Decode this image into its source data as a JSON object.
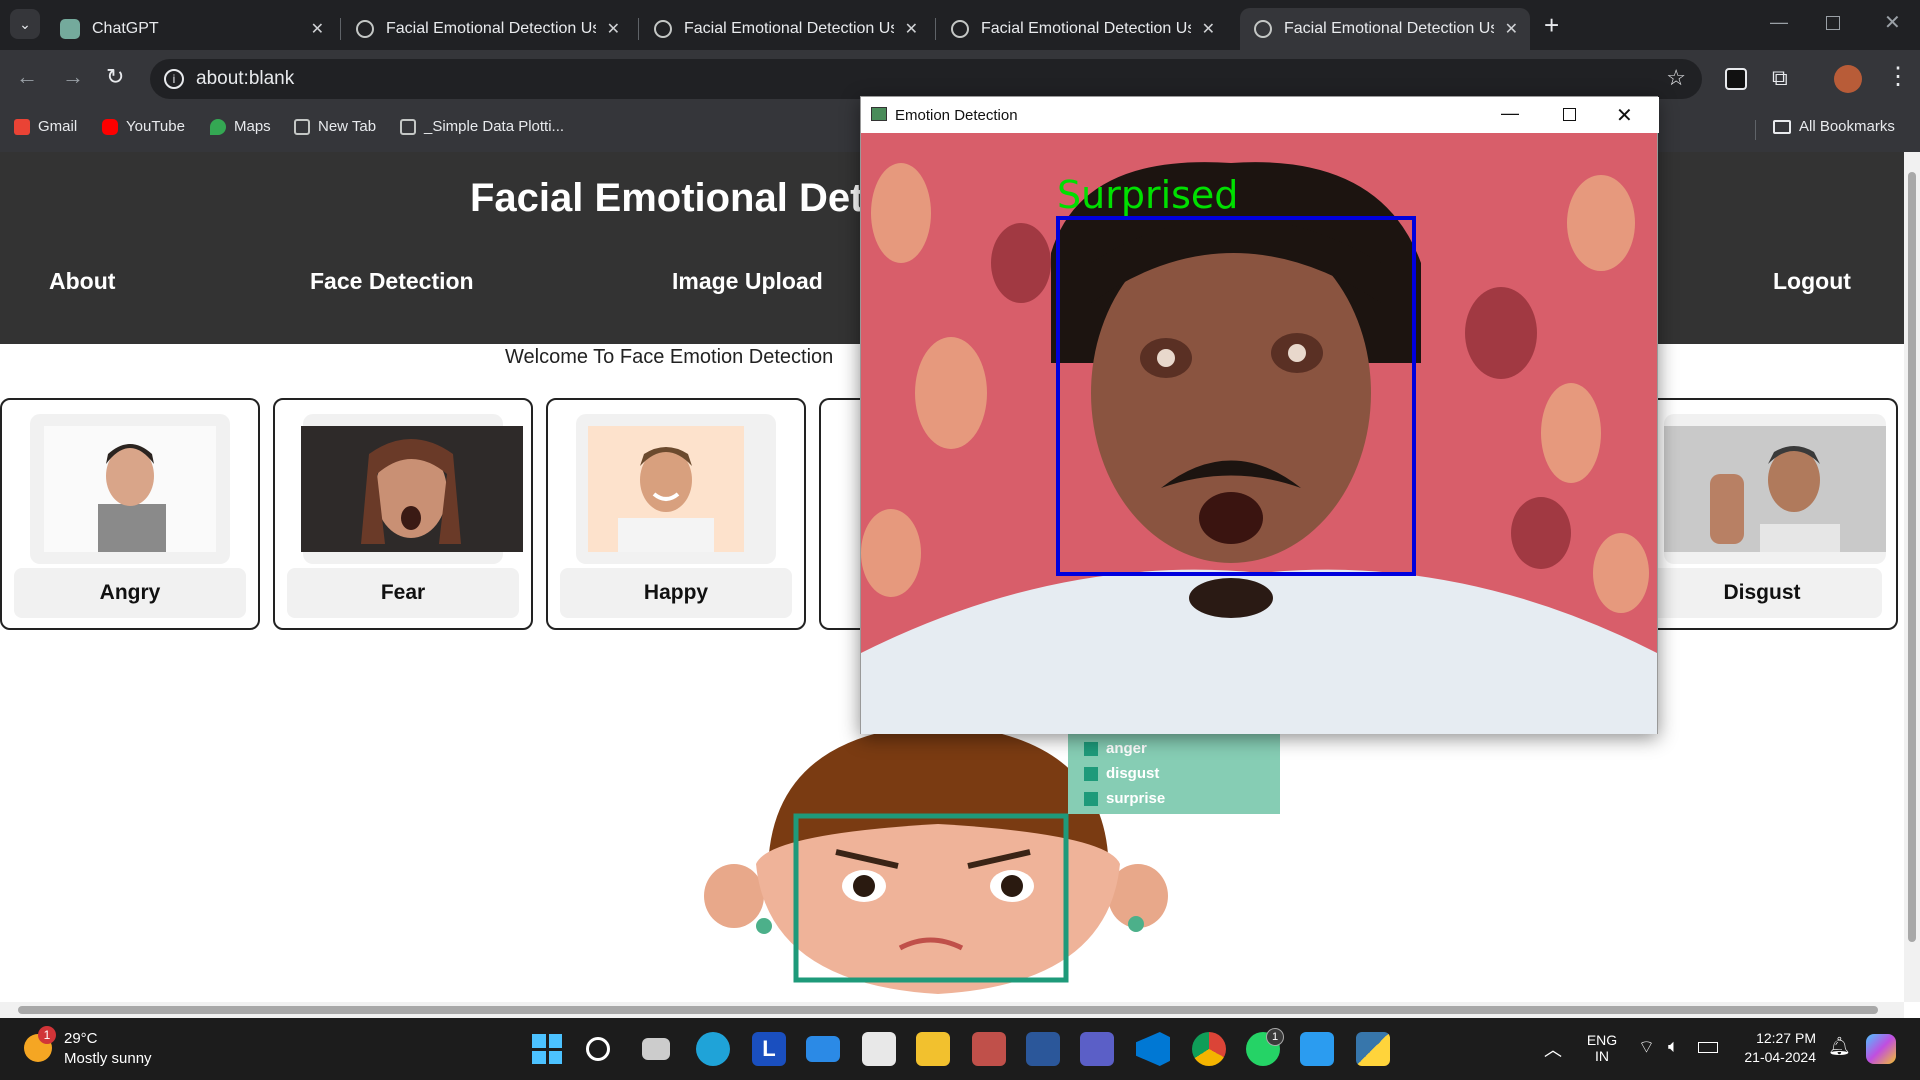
{
  "browser": {
    "tabs": [
      {
        "title": "ChatGPT",
        "icon": "chatgpt-icon",
        "active": false
      },
      {
        "title": "Facial Emotional Detection Usi",
        "icon": "globe-icon",
        "active": false
      },
      {
        "title": "Facial Emotional Detection Usi",
        "icon": "globe-icon",
        "active": false
      },
      {
        "title": "Facial Emotional Detection Usi",
        "icon": "globe-icon",
        "active": false
      },
      {
        "title": "Facial Emotional Detection Usi",
        "icon": "globe-icon",
        "active": true
      }
    ],
    "new_tab_symbol": "+",
    "address": "about:blank",
    "bookmarks": [
      "Gmail",
      "YouTube",
      "Maps",
      "New Tab",
      "_Simple Data Plotti..."
    ],
    "all_bookmarks": "All Bookmarks"
  },
  "site": {
    "title": "Facial Emotional Det",
    "nav": {
      "about": "About",
      "face_detection": "Face Detection",
      "image_upload": "Image Upload",
      "logout": "Logout"
    },
    "welcome": "Welcome To Face Emotion Detection",
    "cards": [
      "Angry",
      "Fear",
      "Happy",
      "Disgust"
    ],
    "legend": [
      "anger",
      "disgust",
      "surprise"
    ]
  },
  "cv_window": {
    "title": "Emotion Detection",
    "emotion_label": "Surprised",
    "label_color": "#00e000",
    "box_color": "#0000dd"
  },
  "taskbar": {
    "temperature": "29°C",
    "weather": "Mostly sunny",
    "weather_badge": "1",
    "whatsapp_badge": "1",
    "lang_1": "ENG",
    "lang_2": "IN",
    "time": "12:27 PM",
    "date": "21-04-2024"
  }
}
